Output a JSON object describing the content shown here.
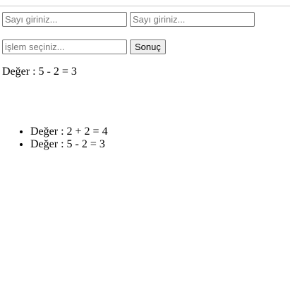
{
  "form": {
    "first_number": {
      "value": "",
      "placeholder": "Sayı giriniz..."
    },
    "second_number": {
      "value": "",
      "placeholder": "Sayı giriniz..."
    },
    "operation": {
      "value": "",
      "placeholder": "işlem seçiniz..."
    },
    "submit_label": "Sonuç"
  },
  "result": {
    "text": "Değer : 5 - 2 = 3"
  },
  "history": [
    {
      "text": "Değer : 2 + 2 = 4"
    },
    {
      "text": "Değer : 5 - 2 = 3"
    }
  ],
  "colors": {
    "background": "#ffffff",
    "field_border": "#767676",
    "placeholder": "#767676",
    "button_background": "#efefef"
  }
}
